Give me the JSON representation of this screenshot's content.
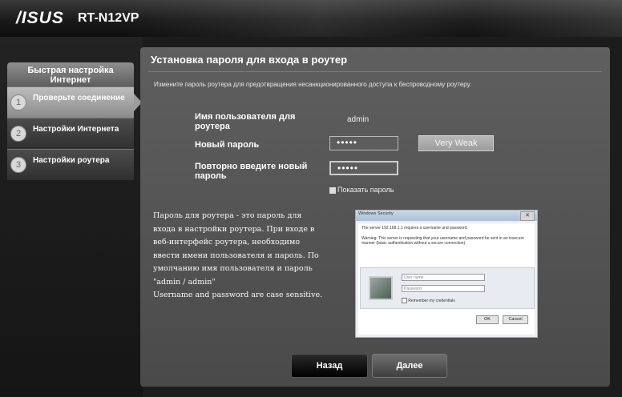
{
  "header": {
    "brand": "/ISUS",
    "model": "RT-N12VP"
  },
  "sidebar": {
    "title": "Быстрая настройка Интернет",
    "steps": [
      {
        "num": "1",
        "label": "Проверьте соединение"
      },
      {
        "num": "2",
        "label": "Настройки Интернета"
      },
      {
        "num": "3",
        "label": "Настройки роутера"
      }
    ]
  },
  "main": {
    "title": "Установка пароля для входа в роутер",
    "description": "Измените пароль роутера для предотвращения несанкционированного доступа к беспроводному роутеру.",
    "username_label": "Имя пользователя для роутера",
    "username_value": "admin",
    "new_password_label": "Новый пароль",
    "new_password_value": "•••••",
    "strength": "Very Weak",
    "repeat_password_label": "Повторно введите новый пароль",
    "repeat_password_value": "•••••",
    "show_password_label": "Показать пароль",
    "info_lines": [
      "Пароль для роутера - это пароль для",
      "входа в настройки роутера. При входе в",
      "веб-интерфейс роутера, необходимо",
      "ввести имени пользователя и пароль. По",
      "умолчанию имя пользователя и пароль",
      "\"admin / admin\"",
      "Username and password are case sensitive."
    ]
  },
  "dialog": {
    "title": "Windows Security",
    "close": "✕",
    "line1": "The server 192.168.1.1 requires a username and password.",
    "line2": "Warning: This server is requesting that your username and password be sent in an insecure manner (basic authentication without a secure connection).",
    "username_placeholder": "User name",
    "password_placeholder": "Password",
    "remember": "Remember my credentials",
    "ok": "OK",
    "cancel": "Cancel"
  },
  "buttons": {
    "back": "Назад",
    "next": "Далее"
  },
  "colors": {
    "panel": "#555555",
    "active_step": "#a8a8a8",
    "back_button": "#111111"
  }
}
